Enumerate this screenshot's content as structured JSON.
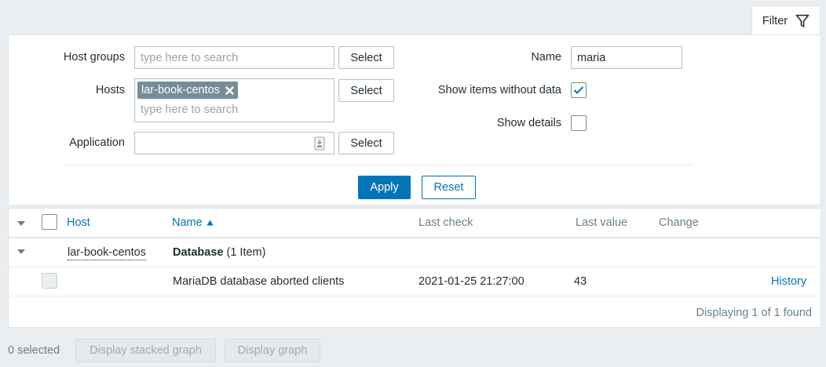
{
  "filter_tab": {
    "label": "Filter",
    "icon": "funnel-icon"
  },
  "filter": {
    "host_groups": {
      "label": "Host groups",
      "placeholder": "type here to search",
      "select_label": "Select"
    },
    "hosts": {
      "label": "Hosts",
      "chip": "lar-book-centos",
      "placeholder": "type here to search",
      "select_label": "Select"
    },
    "application": {
      "label": "Application",
      "value": "",
      "select_label": "Select"
    },
    "name": {
      "label": "Name",
      "value": "maria"
    },
    "show_items_without_data": {
      "label": "Show items without data",
      "checked": true
    },
    "show_details": {
      "label": "Show details",
      "checked": false
    },
    "apply_label": "Apply",
    "reset_label": "Reset"
  },
  "table": {
    "columns": {
      "host": "Host",
      "name": "Name",
      "last_check": "Last check",
      "last_value": "Last value",
      "change": "Change"
    },
    "group": {
      "host": "lar-book-centos",
      "app_name": "Database",
      "count": "(1 Item)"
    },
    "rows": [
      {
        "name": "MariaDB database aborted clients",
        "last_check": "2021-01-25 21:27:00",
        "last_value": "43",
        "change": "",
        "action": "History"
      }
    ],
    "footer": "Displaying 1 of 1 found"
  },
  "bottom": {
    "selected": "0 selected",
    "stacked_graph": "Display stacked graph",
    "graph": "Display graph"
  },
  "colors": {
    "accent": "#0275b8",
    "background": "#ebeef0",
    "chip": "#768d99"
  }
}
